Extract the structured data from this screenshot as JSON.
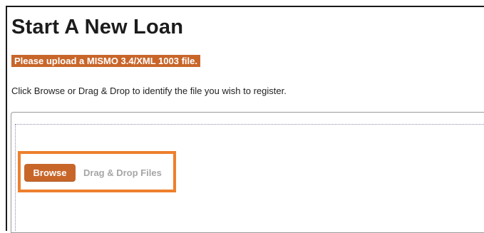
{
  "page": {
    "title": "Start A New Loan",
    "upload_notice": "Please upload a MISMO 3.4/XML 1003 file.",
    "instructions": "Click Browse or Drag & Drop to identify the file you wish to register."
  },
  "upload": {
    "browse_label": "Browse",
    "dragdrop_label": "Drag & Drop Files"
  },
  "colors": {
    "accent": "#c8662a",
    "highlight_border": "#ee7f2d",
    "muted_text": "#a6a6a6"
  }
}
